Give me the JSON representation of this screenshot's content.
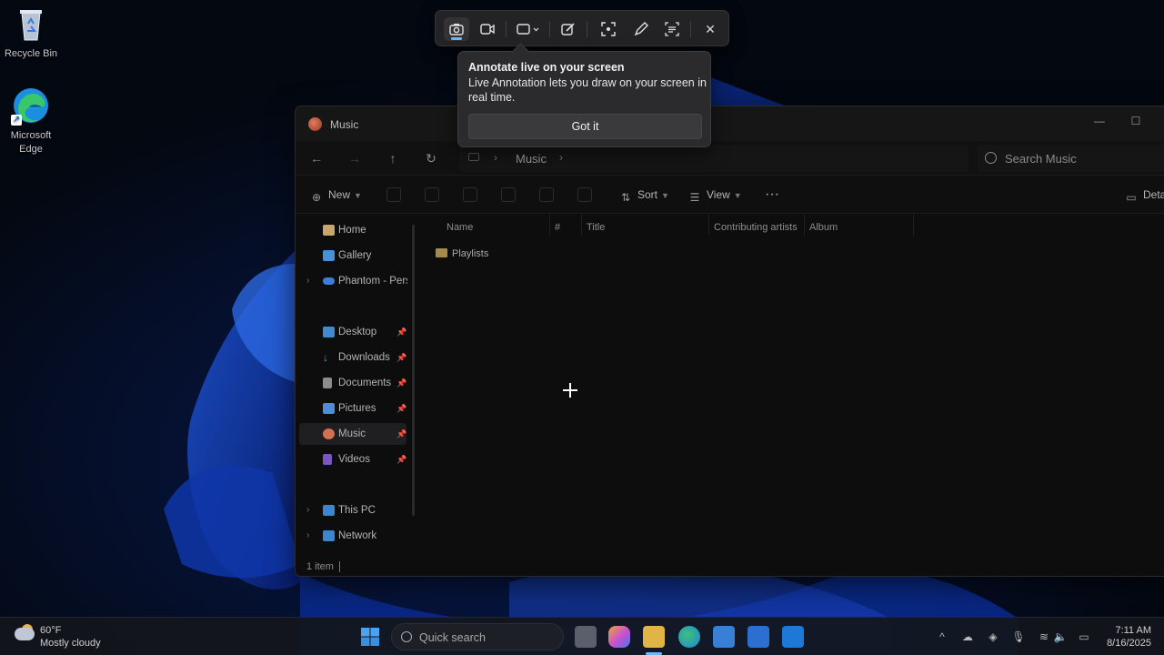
{
  "desktop": {
    "icons": [
      {
        "label": "Recycle Bin",
        "icon": "recycle-bin-icon"
      },
      {
        "label": "Microsoft Edge",
        "icon": "edge-icon"
      }
    ]
  },
  "snipping_toolbar": {
    "tools": [
      {
        "name": "screenshot-mode",
        "icon": "camera-icon",
        "active": true
      },
      {
        "name": "record-mode",
        "icon": "video-camera-icon",
        "active": false
      },
      {
        "name": "snip-shape",
        "icon": "rectangle-snip-icon",
        "active": false
      },
      {
        "name": "edit",
        "icon": "pen-edit-icon",
        "active": false
      },
      {
        "name": "visual-search",
        "icon": "visual-search-icon",
        "active": false
      },
      {
        "name": "live-annotation",
        "icon": "pen-icon",
        "active": false
      },
      {
        "name": "text-actions",
        "icon": "text-extract-icon",
        "active": false
      },
      {
        "name": "close",
        "icon": "close-icon",
        "active": false
      }
    ]
  },
  "teaching_tip": {
    "title": "Annotate live on your screen",
    "body": "Live Annotation lets you draw on your screen in real time.",
    "button": "Got it"
  },
  "explorer": {
    "title": "Music",
    "breadcrumb": [
      "Music"
    ],
    "search_placeholder": "Search Music",
    "commands": {
      "new": "New",
      "sort": "Sort",
      "view": "View",
      "details": "Deta"
    },
    "nav_items": [
      {
        "label": "Home",
        "icon": "home-icon",
        "pinned": false,
        "expandable": false,
        "color": "#c9a66b"
      },
      {
        "label": "Gallery",
        "icon": "gallery-icon",
        "pinned": false,
        "expandable": false,
        "color": "#4a90d9"
      },
      {
        "label": "Phantom - Persc",
        "icon": "onedrive-icon",
        "pinned": false,
        "expandable": true,
        "color": "#3d7fd6"
      },
      {
        "label": "Desktop",
        "icon": "desktop-icon",
        "pinned": true,
        "expandable": false,
        "color": "#3f8ad1"
      },
      {
        "label": "Downloads",
        "icon": "downloads-icon",
        "pinned": true,
        "expandable": false,
        "color": "#3aa0d8"
      },
      {
        "label": "Documents",
        "icon": "documents-icon",
        "pinned": true,
        "expandable": false,
        "color": "#8c8c8c"
      },
      {
        "label": "Pictures",
        "icon": "pictures-icon",
        "pinned": true,
        "expandable": false,
        "color": "#4c8fd6"
      },
      {
        "label": "Music",
        "icon": "music-icon",
        "pinned": true,
        "expandable": false,
        "color": "#d2704f",
        "selected": true
      },
      {
        "label": "Videos",
        "icon": "videos-icon",
        "pinned": true,
        "expandable": false,
        "color": "#7b55c4"
      },
      {
        "label": "This PC",
        "icon": "this-pc-icon",
        "pinned": false,
        "expandable": true,
        "color": "#3c86d0"
      },
      {
        "label": "Network",
        "icon": "network-icon",
        "pinned": false,
        "expandable": true,
        "color": "#3c86d0"
      }
    ],
    "columns": [
      "Name",
      "#",
      "Title",
      "Contributing artists",
      "Album"
    ],
    "rows": [
      {
        "name": "Playlists",
        "icon": "folder-icon"
      }
    ],
    "status": "1 item"
  },
  "taskbar": {
    "weather": {
      "temp": "60°F",
      "condition": "Mostly cloudy"
    },
    "search_placeholder": "Quick search",
    "apps": [
      "start-icon",
      "task-view-icon",
      "copilot-icon",
      "file-explorer-icon",
      "edge-icon",
      "microsoft-store-icon",
      "word-icon",
      "outlook-icon"
    ],
    "clock": {
      "time": "7:11 AM",
      "date": "8/16/2025"
    }
  }
}
